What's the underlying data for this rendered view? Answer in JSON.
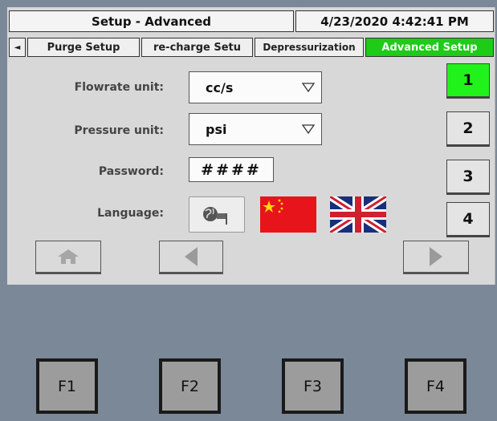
{
  "header": {
    "title": "Setup - Advanced",
    "datetime": "4/23/2020 4:42:41 PM"
  },
  "tabs": {
    "scroll_left": "◄",
    "items": [
      {
        "label": "Purge Setup"
      },
      {
        "label": "re-charge Setu"
      },
      {
        "label": "Depressurization"
      },
      {
        "label": "Advanced Setup",
        "active": true
      }
    ]
  },
  "form": {
    "flowrate": {
      "label": "Flowrate unit:",
      "value": "cc/s"
    },
    "pressure": {
      "label": "Pressure unit:",
      "value": "psi"
    },
    "password": {
      "label": "Password:",
      "value": "####"
    },
    "language": {
      "label": "Language:",
      "options": [
        "globe-icon",
        "china-flag-icon",
        "uk-flag-icon"
      ]
    }
  },
  "pages": {
    "items": [
      "1",
      "2",
      "3",
      "4"
    ],
    "active": "1"
  },
  "nav": {
    "icons": [
      "home-icon",
      "arrow-left-icon",
      "arrow-right-icon"
    ]
  },
  "function_keys": [
    "F1",
    "F2",
    "F3",
    "F4"
  ],
  "colors": {
    "active_tab": "#1ecc17",
    "active_page": "#21f21c",
    "screen_bg": "#d8d8d8",
    "panel_bg": "#7a8897"
  }
}
